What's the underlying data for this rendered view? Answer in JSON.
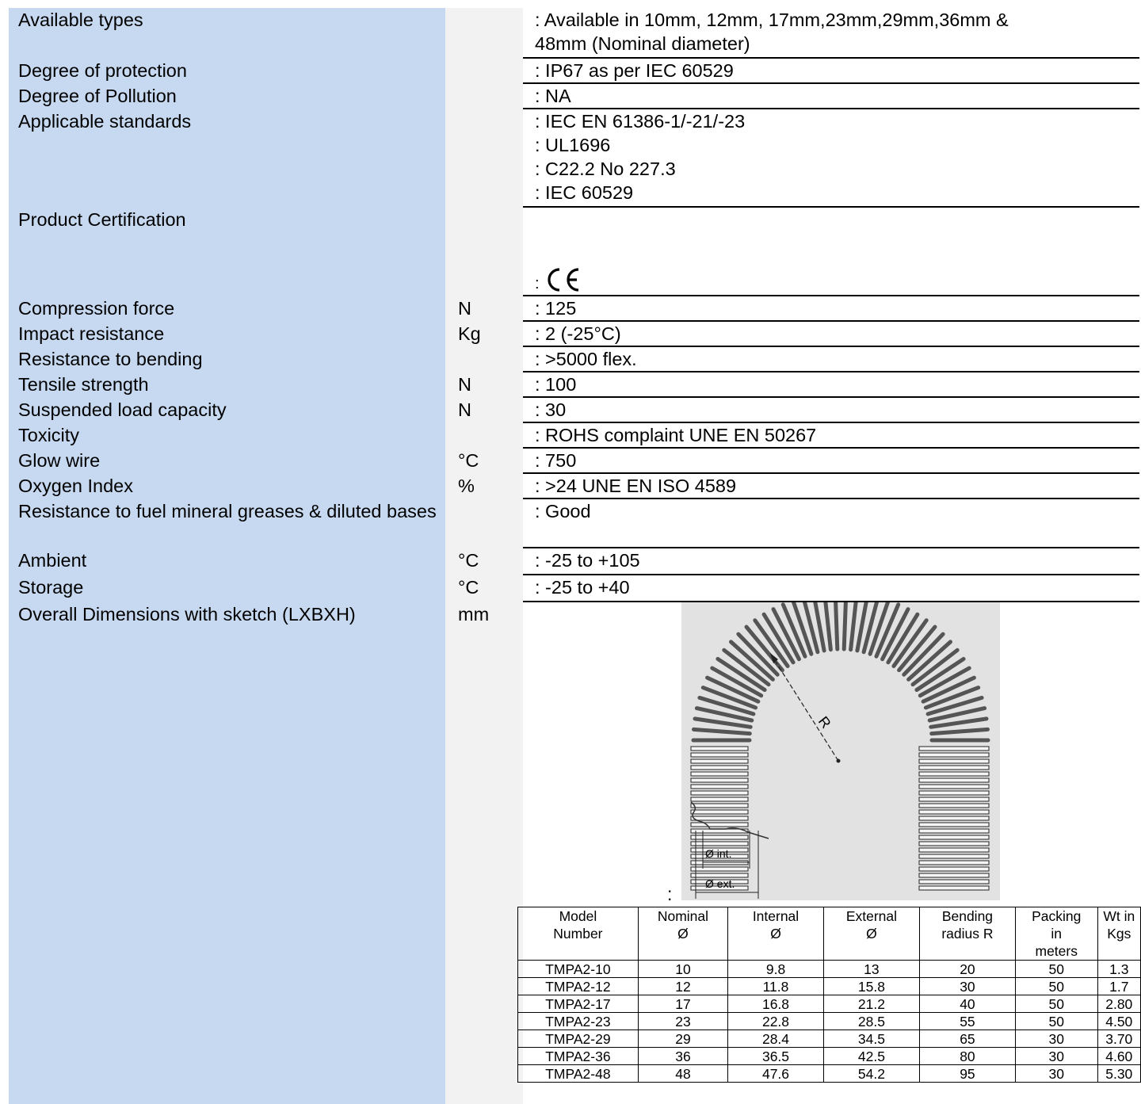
{
  "specs": [
    {
      "label": "Available types",
      "unit": "",
      "lines": [
        ": Available in 10mm, 12mm, 17mm,23mm,29mm,36mm &",
        "48mm (Nominal diameter)"
      ]
    },
    {
      "label": "Degree of protection",
      "unit": "",
      "lines": [
        ": IP67 as per IEC 60529"
      ]
    },
    {
      "label": "Degree of Pollution",
      "unit": "",
      "lines": [
        ": NA"
      ]
    },
    {
      "label": "Applicable standards",
      "unit": "",
      "lines": [
        ": IEC EN 61386-1/-21/-23",
        ": UL1696",
        ": C22.2 No 227.3",
        ": IEC 60529"
      ]
    },
    {
      "label": "Product Certification",
      "unit": "",
      "lines": [
        ":"
      ]
    },
    {
      "label": "Compression force",
      "unit": "N",
      "lines": [
        ": 125"
      ]
    },
    {
      "label": "Impact resistance",
      "unit": "Kg",
      "lines": [
        ": 2 (-25°C)"
      ]
    },
    {
      "label": "Resistance to bending",
      "unit": "",
      "lines": [
        ": >5000 flex."
      ]
    },
    {
      "label": "Tensile strength",
      "unit": "N",
      "lines": [
        ": 100"
      ]
    },
    {
      "label": "Suspended load capacity",
      "unit": "N",
      "lines": [
        ": 30"
      ]
    },
    {
      "label": "Toxicity",
      "unit": "",
      "lines": [
        ": ROHS complaint UNE EN 50267"
      ]
    },
    {
      "label": "Glow wire",
      "unit": "°C",
      "lines": [
        ": 750"
      ]
    },
    {
      "label": "Oxygen Index",
      "unit": "%",
      "lines": [
        ": >24 UNE EN ISO 4589"
      ]
    },
    {
      "label": "Resistance to fuel mineral greases & diluted bases",
      "unit": "",
      "lines": [
        ": Good"
      ]
    },
    {
      "label": "Ambient",
      "unit": "°C",
      "lines": [
        ": -25 to +105"
      ]
    },
    {
      "label": "Storage",
      "unit": "°C",
      "lines": [
        ": -25 to +40"
      ]
    },
    {
      "label": "Overall Dimensions with sketch (LXBXH)",
      "unit": "mm",
      "lines": [
        ":"
      ]
    }
  ],
  "certification_mark": "CE",
  "sketch": {
    "radius_label": "R",
    "int_label": "Ø int.",
    "ext_label": "Ø ext."
  },
  "model_table": {
    "headers": [
      [
        "Model",
        "Number"
      ],
      [
        "Nominal",
        "Ø"
      ],
      [
        "Internal",
        "Ø"
      ],
      [
        "External",
        "Ø"
      ],
      [
        "Bending",
        "radius R"
      ],
      [
        "Packing",
        "in",
        "meters"
      ],
      [
        "Wt in",
        "Kgs"
      ]
    ],
    "rows": [
      [
        "TMPA2-10",
        "10",
        "9.8",
        "13",
        "20",
        "50",
        "1.3"
      ],
      [
        "TMPA2-12",
        "12",
        "11.8",
        "15.8",
        "30",
        "50",
        "1.7"
      ],
      [
        "TMPA2-17",
        "17",
        "16.8",
        "21.2",
        "40",
        "50",
        "2.80"
      ],
      [
        "TMPA2-23",
        "23",
        "22.8",
        "28.5",
        "55",
        "50",
        "4.50"
      ],
      [
        "TMPA2-29",
        "29",
        "28.4",
        "34.5",
        "65",
        "30",
        "3.70"
      ],
      [
        "TMPA2-36",
        "36",
        "36.5",
        "42.5",
        "80",
        "30",
        "4.60"
      ],
      [
        "TMPA2-48",
        "48",
        "47.6",
        "54.2",
        "95",
        "30",
        "5.30"
      ]
    ]
  }
}
